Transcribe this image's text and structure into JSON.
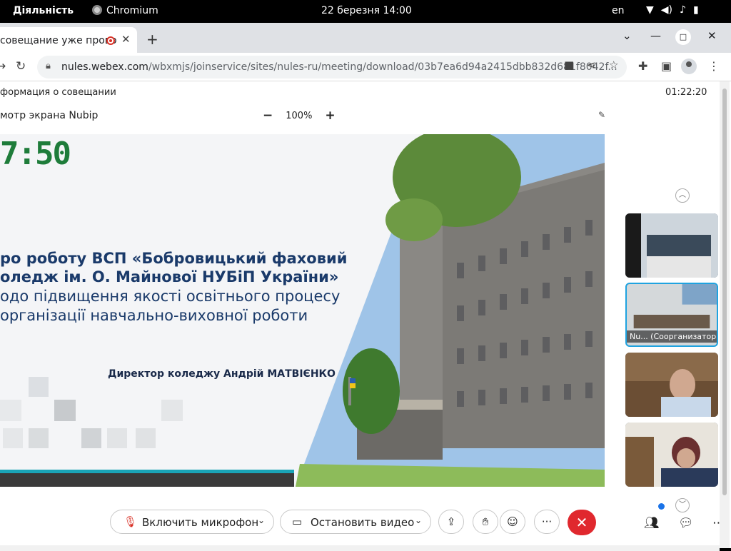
{
  "topbar": {
    "activities": "Діяльність",
    "app_name": "Chromium",
    "datetime": "22 березня  14:00",
    "lang": "en"
  },
  "tab": {
    "title": "совещание уже прово",
    "close": "✕"
  },
  "toolbar": {
    "url_host": "nules.webex.com",
    "url_path": "/wbxmjs/joinservice/sites/nules-ru/meeting/download/03b7ea6d94a2415dbb832d681f8042f..."
  },
  "meeting": {
    "info_label": "формация о совещании",
    "elapsed": "01:22:20",
    "share_label": "мотр экрана Nubip",
    "zoom_level": "100%",
    "zoom_minus": "−",
    "zoom_plus": "+"
  },
  "slide": {
    "clock_text": "7:50",
    "line1": "ро роботу ВСП «Бобровицький фаховий",
    "line2": "оледж ім. О. Майнової НУБіП України»",
    "line3": "одо підвищення якості освітнього процесу",
    "line4": " організації навчально-виховної роботи",
    "director": "Директор коледжу Андрій МАТВІЄНКО"
  },
  "participants": [
    {
      "name": ""
    },
    {
      "name": "Nu...  (Соорганизатор)"
    },
    {
      "name": ""
    },
    {
      "name": ""
    }
  ],
  "controls": {
    "mic_label": "Включить микрофон",
    "video_label": "Остановить видео",
    "more": "···",
    "end": "✕"
  },
  "colors": {
    "accent": "#1fa3e0",
    "end_call": "#e0282e",
    "slide_title": "#1a3a6a"
  }
}
